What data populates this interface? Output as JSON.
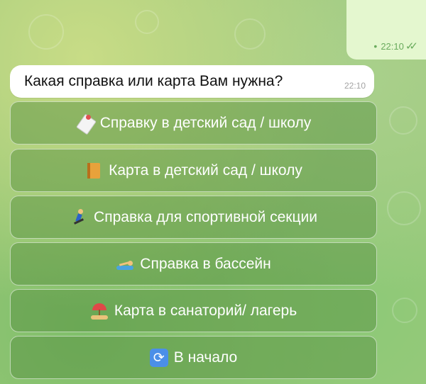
{
  "previous_message": {
    "time": "22:10"
  },
  "message": {
    "text": "Какая справка или карта Вам нужна?",
    "time": "22:10"
  },
  "keyboard": [
    {
      "label": "Справку в детский сад / школу",
      "icon": "memo-icon"
    },
    {
      "label": "Карта в детский сад / школу",
      "icon": "notebook-icon"
    },
    {
      "label": "Справка для спортивной секции",
      "icon": "runner-icon"
    },
    {
      "label": "Справка в бассейн",
      "icon": "swimmer-icon"
    },
    {
      "label": "Карта в санаторий/ лагерь",
      "icon": "beach-umbrella-icon"
    },
    {
      "label": "В начало",
      "icon": "restart-icon"
    }
  ]
}
